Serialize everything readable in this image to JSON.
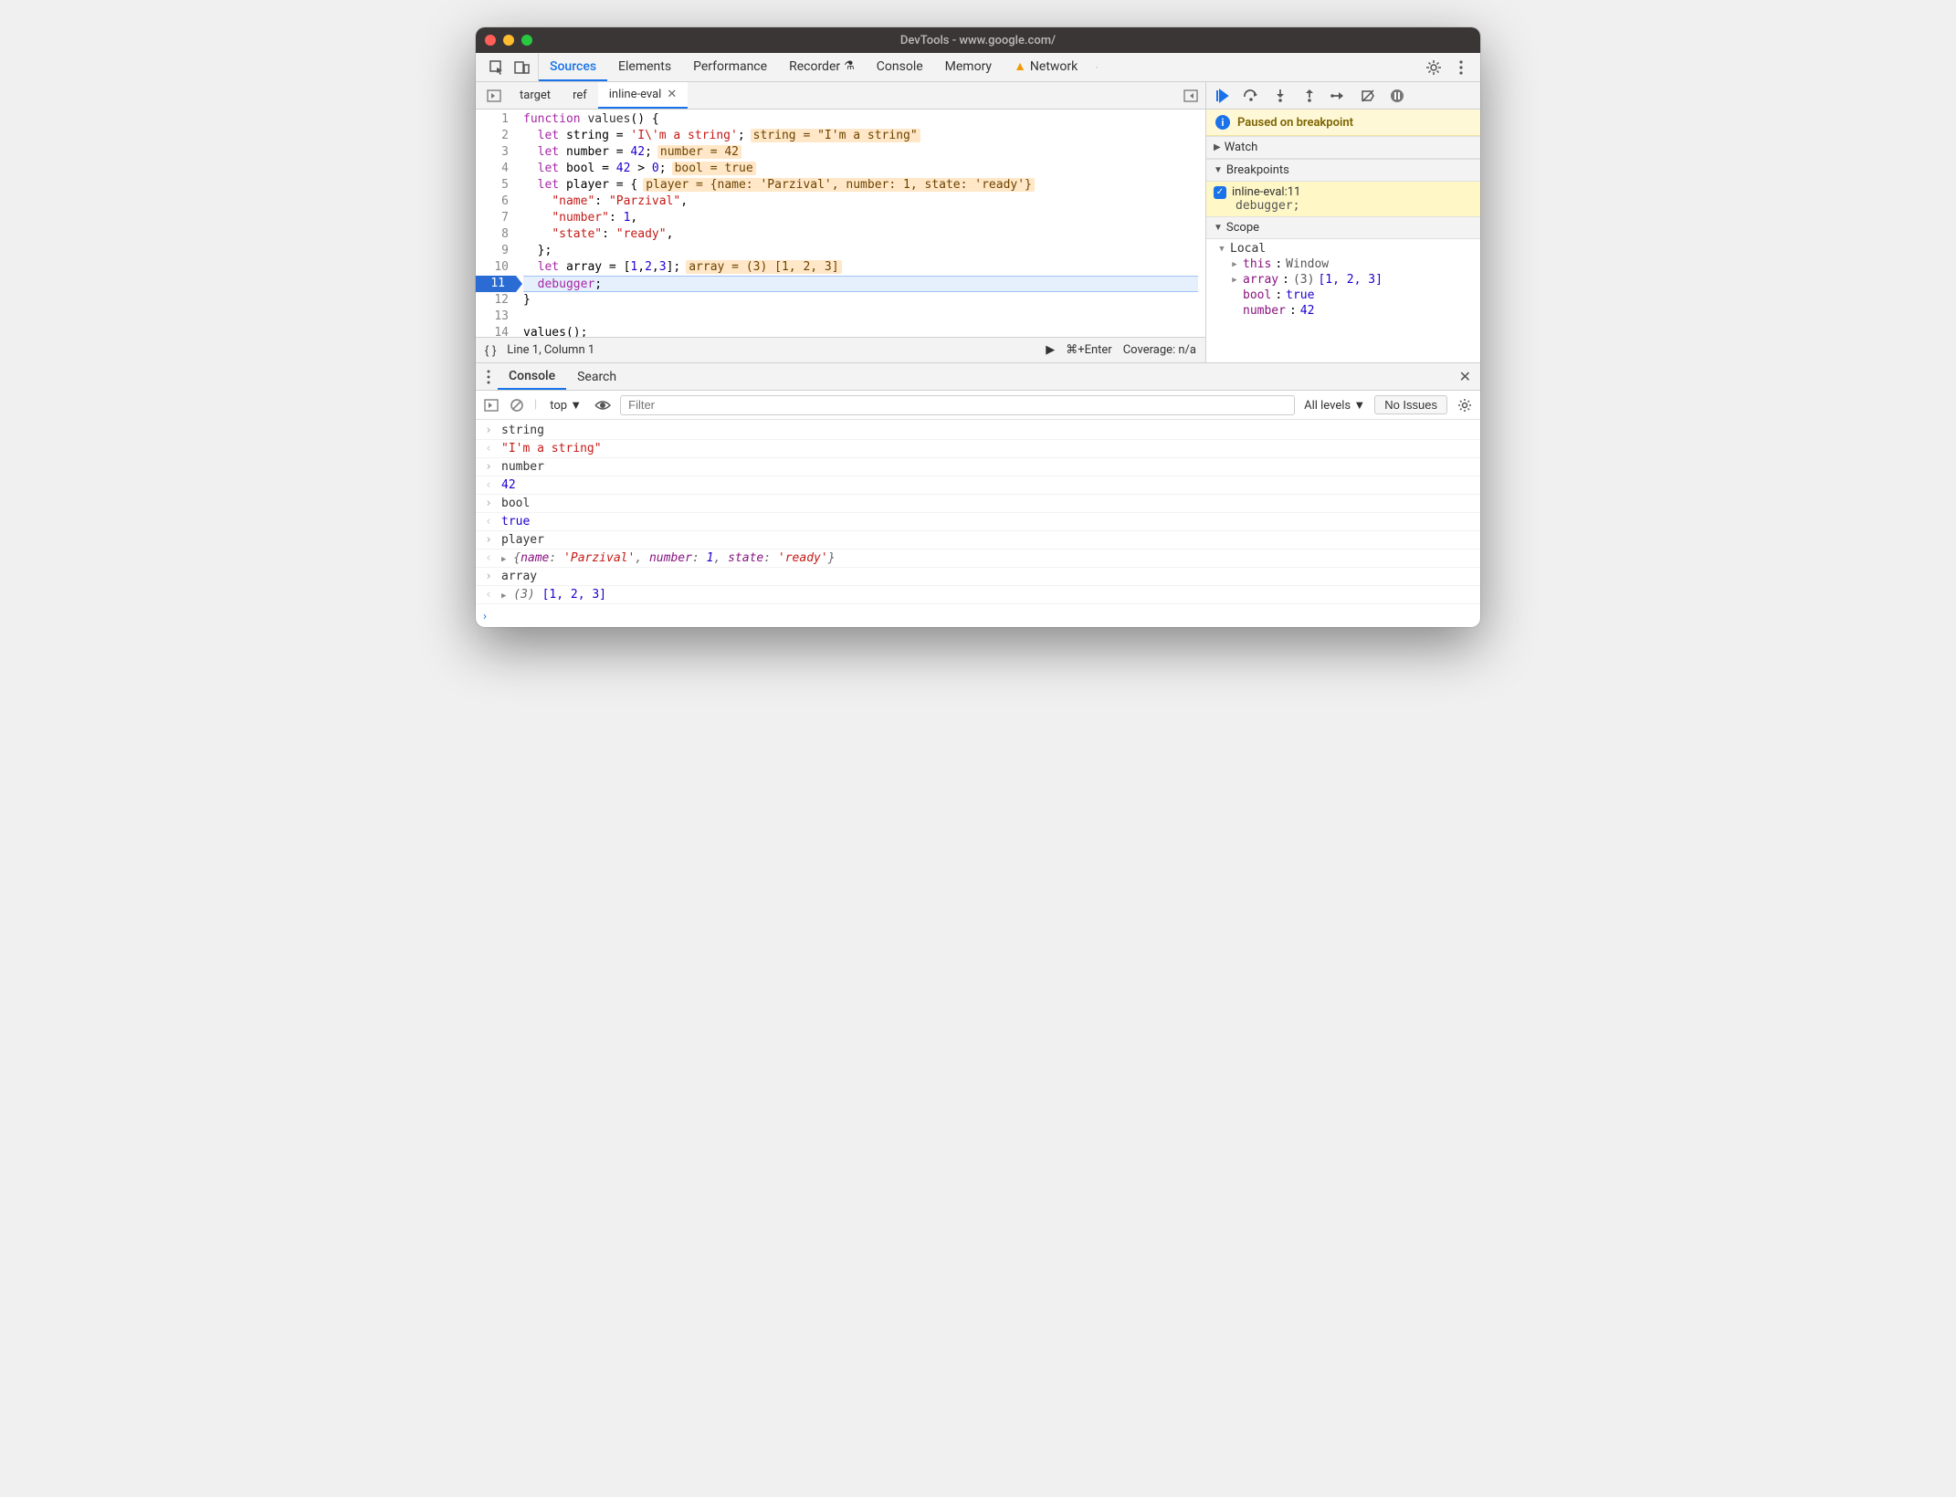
{
  "titlebar": {
    "title": "DevTools - www.google.com/"
  },
  "panels": {
    "tabs": [
      "Sources",
      "Elements",
      "Performance",
      "Recorder",
      "Console",
      "Memory",
      "Network"
    ],
    "active": "Sources",
    "recorder_beaker": true,
    "network_warning": true
  },
  "sources": {
    "tabs": [
      {
        "label": "target",
        "active": false,
        "closeable": false
      },
      {
        "label": "ref",
        "active": false,
        "closeable": false
      },
      {
        "label": "inline-eval",
        "active": true,
        "closeable": true
      }
    ],
    "code_lines": [
      {
        "n": 1,
        "html": "<span class='kw'>function</span> <span class='ident'>values</span>() {"
      },
      {
        "n": 2,
        "html": "  <span class='kw2'>let</span> string = <span class='str'>'I\\'m a string'</span>;",
        "inline": "string = \"I'm a string\""
      },
      {
        "n": 3,
        "html": "  <span class='kw2'>let</span> number = <span class='num'>42</span>;",
        "inline": "number = 42"
      },
      {
        "n": 4,
        "html": "  <span class='kw2'>let</span> bool = <span class='num'>42</span> > <span class='num'>0</span>;",
        "inline": "bool = true"
      },
      {
        "n": 5,
        "html": "  <span class='kw2'>let</span> player = {",
        "inline": "player = {name: 'Parzival', number: 1, state: 'ready'}"
      },
      {
        "n": 6,
        "html": "    <span class='prop'>\"name\"</span>: <span class='str'>\"Parzival\"</span>,"
      },
      {
        "n": 7,
        "html": "    <span class='prop'>\"number\"</span>: <span class='num'>1</span>,"
      },
      {
        "n": 8,
        "html": "    <span class='prop'>\"state\"</span>: <span class='str'>\"ready\"</span>,"
      },
      {
        "n": 9,
        "html": "  };"
      },
      {
        "n": 10,
        "html": "  <span class='kw2'>let</span> array = [<span class='num'>1</span>,<span class='num'>2</span>,<span class='num'>3</span>];",
        "inline": "array = (3) [1, 2, 3]"
      },
      {
        "n": 11,
        "html": "  <span class='kw'>debugger</span>;",
        "paused": true,
        "breakpoint": true
      },
      {
        "n": 12,
        "html": "}"
      },
      {
        "n": 13,
        "html": ""
      },
      {
        "n": 14,
        "html": "values();"
      }
    ],
    "status": {
      "position": "Line 1, Column 1",
      "run_hint": "⌘+Enter",
      "coverage": "Coverage: n/a"
    }
  },
  "debugger": {
    "paused_message": "Paused on breakpoint",
    "sections": {
      "watch": "Watch",
      "breakpoints": "Breakpoints",
      "scope": "Scope"
    },
    "breakpoint": {
      "file": "inline-eval:11",
      "code": "debugger;"
    },
    "scope": {
      "kind": "Local",
      "rows": [
        {
          "expandable": true,
          "key": "this",
          "val": "Window",
          "valClass": "sc-type"
        },
        {
          "expandable": true,
          "key": "array",
          "val": "(3) [1, 2, 3]",
          "valClass": "sc-arr",
          "pre": "(3) ",
          "arr": "[1, 2, 3]"
        },
        {
          "expandable": false,
          "key": "bool",
          "val": "true",
          "valClass": "sc-arr"
        },
        {
          "expandable": false,
          "key": "number",
          "val": "42",
          "valClass": "sc-num"
        }
      ]
    }
  },
  "drawer": {
    "tabs": [
      "Console",
      "Search"
    ],
    "active": "Console",
    "toolbar": {
      "context": "top",
      "filter_placeholder": "Filter",
      "levels": "All levels",
      "issues": "No Issues"
    },
    "entries": [
      {
        "dir": "in",
        "text": "string"
      },
      {
        "dir": "out",
        "html": "<span class='cval-str'>\"I'm a string\"</span>"
      },
      {
        "dir": "in",
        "text": "number"
      },
      {
        "dir": "out",
        "html": "<span class='cval-num'>42</span>"
      },
      {
        "dir": "in",
        "text": "bool"
      },
      {
        "dir": "out",
        "html": "<span class='cval-bool'>true</span>"
      },
      {
        "dir": "in",
        "text": "player"
      },
      {
        "dir": "out",
        "expandable": true,
        "html": "<span class='cval-obj'>{<span class='k'>name</span>: <span class='v'>'Parzival'</span>, <span class='k'>number</span>: <span class='vn'>1</span>, <span class='k'>state</span>: <span class='v'>'ready'</span>}</span>"
      },
      {
        "dir": "in",
        "text": "array"
      },
      {
        "dir": "out",
        "expandable": true,
        "html": "<span class='cval-obj'>(3) </span><span class='cval-num'>[1, 2, 3]</span>"
      }
    ]
  }
}
